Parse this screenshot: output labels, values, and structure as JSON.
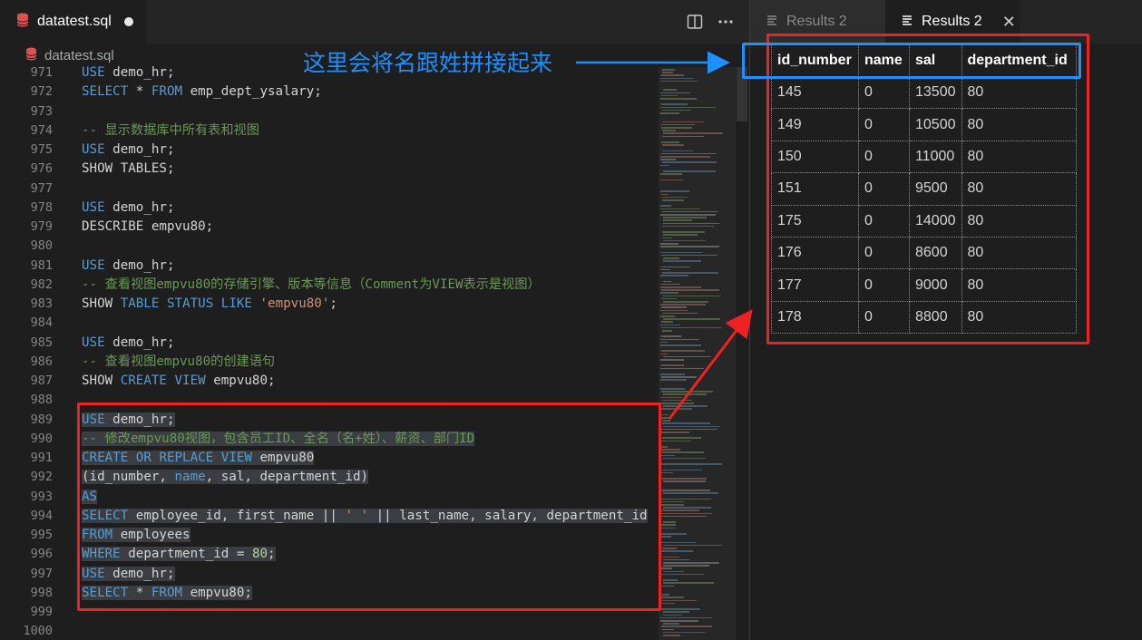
{
  "editor": {
    "tab_label": "datatest.sql",
    "breadcrumb_label": "datatest.sql",
    "line_numbers": [
      "971",
      "972",
      "973",
      "974",
      "975",
      "976",
      "977",
      "978",
      "979",
      "980",
      "981",
      "982",
      "983",
      "984",
      "985",
      "986",
      "987",
      "988",
      "989",
      "990",
      "991",
      "992",
      "993",
      "994",
      "995",
      "996",
      "997",
      "998",
      "999",
      "1000"
    ],
    "code_lines": [
      [
        [
          "kw",
          "USE"
        ],
        [
          "plain",
          " demo_hr;"
        ]
      ],
      [
        [
          "kw",
          "SELECT"
        ],
        [
          "plain",
          " * "
        ],
        [
          "kw",
          "FROM"
        ],
        [
          "plain",
          " emp_dept_ysalary;"
        ]
      ],
      [],
      [
        [
          "cm",
          "-- 显示数据库中所有表和视图"
        ]
      ],
      [
        [
          "kw",
          "USE"
        ],
        [
          "plain",
          " demo_hr;"
        ]
      ],
      [
        [
          "plain",
          "SHOW TABLES;"
        ]
      ],
      [],
      [
        [
          "kw",
          "USE"
        ],
        [
          "plain",
          " demo_hr;"
        ]
      ],
      [
        [
          "plain",
          "DESCRIBE empvu80;"
        ]
      ],
      [],
      [
        [
          "kw",
          "USE"
        ],
        [
          "plain",
          " demo_hr;"
        ]
      ],
      [
        [
          "cm",
          "-- 查看视图empvu80的存储引擎、版本等信息（Comment为VIEW表示是视图）"
        ]
      ],
      [
        [
          "plain",
          "SHOW "
        ],
        [
          "kw",
          "TABLE"
        ],
        [
          "plain",
          " "
        ],
        [
          "kw",
          "STATUS"
        ],
        [
          "plain",
          " "
        ],
        [
          "kw",
          "LIKE"
        ],
        [
          "plain",
          " "
        ],
        [
          "str",
          "'empvu80'"
        ],
        [
          "plain",
          ";"
        ]
      ],
      [],
      [
        [
          "kw",
          "USE"
        ],
        [
          "plain",
          " demo_hr;"
        ]
      ],
      [
        [
          "cm",
          "-- 查看视图empvu80的创建语句"
        ]
      ],
      [
        [
          "plain",
          "SHOW "
        ],
        [
          "kw",
          "CREATE"
        ],
        [
          "plain",
          " "
        ],
        [
          "kw",
          "VIEW"
        ],
        [
          "plain",
          " empvu80;"
        ]
      ],
      [],
      [
        [
          "kw",
          "USE"
        ],
        [
          "plain",
          " demo_hr;"
        ]
      ],
      [
        [
          "cm",
          "-- 修改empvu80视图，包含员工ID、全名（名+姓）、薪资、部门ID"
        ]
      ],
      [
        [
          "kw",
          "CREATE"
        ],
        [
          "plain",
          " "
        ],
        [
          "kw",
          "OR"
        ],
        [
          "plain",
          " "
        ],
        [
          "kw",
          "REPLACE"
        ],
        [
          "plain",
          " "
        ],
        [
          "kw",
          "VIEW"
        ],
        [
          "plain",
          " empvu80"
        ]
      ],
      [
        [
          "plain",
          "(id_number, "
        ],
        [
          "kw",
          "name"
        ],
        [
          "plain",
          ", sal, department_id)"
        ]
      ],
      [
        [
          "kw",
          "AS"
        ]
      ],
      [
        [
          "kw",
          "SELECT"
        ],
        [
          "plain",
          " employee_id, first_name || "
        ],
        [
          "str",
          "' '"
        ],
        [
          "plain",
          " || last_name, salary, department_id"
        ]
      ],
      [
        [
          "kw",
          "FROM"
        ],
        [
          "plain",
          " employees"
        ]
      ],
      [
        [
          "kw",
          "WHERE"
        ],
        [
          "plain",
          " department_id = "
        ],
        [
          "num",
          "80"
        ],
        [
          "plain",
          ";"
        ]
      ],
      [
        [
          "kw",
          "USE"
        ],
        [
          "plain",
          " demo_hr;"
        ]
      ],
      [
        [
          "kw",
          "SELECT"
        ],
        [
          "plain",
          " * "
        ],
        [
          "kw",
          "FROM"
        ],
        [
          "plain",
          " empvu80;"
        ]
      ],
      [],
      []
    ]
  },
  "results": {
    "tabs": [
      {
        "label": "Results 2",
        "active": false
      },
      {
        "label": "Results 2",
        "active": true
      }
    ],
    "columns": [
      "id_number",
      "name",
      "sal",
      "department_id"
    ],
    "rows": [
      [
        "145",
        "0",
        "13500",
        "80"
      ],
      [
        "149",
        "0",
        "10500",
        "80"
      ],
      [
        "150",
        "0",
        "11000",
        "80"
      ],
      [
        "151",
        "0",
        "9500",
        "80"
      ],
      [
        "175",
        "0",
        "14000",
        "80"
      ],
      [
        "176",
        "0",
        "8600",
        "80"
      ],
      [
        "177",
        "0",
        "9000",
        "80"
      ],
      [
        "178",
        "0",
        "8800",
        "80"
      ]
    ]
  },
  "annotation": {
    "text": "这里会将名跟姓拼接起来",
    "arrow_color": "#1e8fff",
    "box_color": "#ee2222"
  },
  "colors": {
    "keyword": "#569cd6",
    "comment": "#6a9955",
    "string": "#ce9178",
    "number": "#b5cea8",
    "db_icon": "#e05252"
  }
}
